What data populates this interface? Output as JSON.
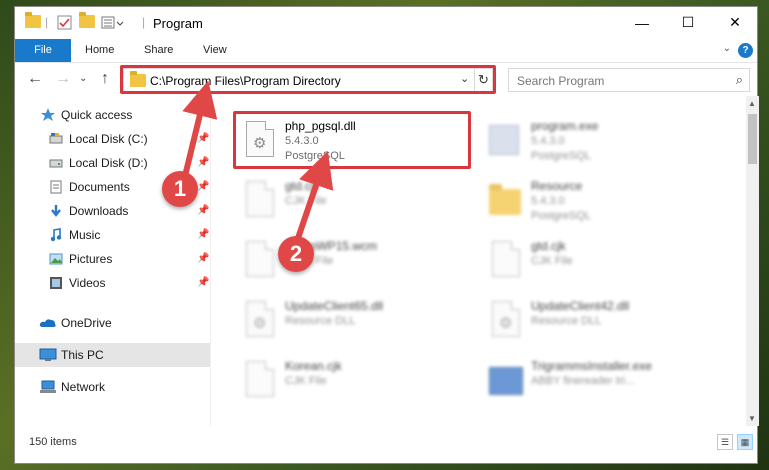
{
  "window": {
    "title": "Program",
    "minimize": "—",
    "maximize": "☐",
    "close": "✕"
  },
  "ribbon": {
    "tabs": [
      "File",
      "Home",
      "Share",
      "View"
    ],
    "help": "?",
    "expand": "⌄"
  },
  "nav": {
    "back": "←",
    "forward": "→",
    "recent": "⌄",
    "up": "↑",
    "address": "C:\\Program Files\\Program Directory",
    "address_chevron": "⌄",
    "refresh": "↻",
    "search_placeholder": "Search Program",
    "search_icon": "⌕"
  },
  "sidebar": {
    "items": [
      {
        "label": "Quick access",
        "icon": "star-icon",
        "pinned": false
      },
      {
        "label": "Local Disk (C:)",
        "icon": "drive-icon",
        "pinned": true
      },
      {
        "label": "Local Disk (D:)",
        "icon": "drive-icon",
        "pinned": true
      },
      {
        "label": "Documents",
        "icon": "documents-icon",
        "pinned": true
      },
      {
        "label": "Downloads",
        "icon": "download-icon",
        "pinned": true
      },
      {
        "label": "Music",
        "icon": "music-icon",
        "pinned": true
      },
      {
        "label": "Pictures",
        "icon": "pictures-icon",
        "pinned": true
      },
      {
        "label": "Videos",
        "icon": "videos-icon",
        "pinned": true
      },
      {
        "label": "OneDrive",
        "icon": "cloud-icon",
        "pinned": false
      },
      {
        "label": "This PC",
        "icon": "pc-icon",
        "pinned": false,
        "selected": true
      },
      {
        "label": "Network",
        "icon": "network-icon",
        "pinned": false
      }
    ],
    "pin_glyph": "📌"
  },
  "files": [
    {
      "name": "php_pgsql.dll",
      "line2": "5.4.3.0",
      "line3": "PostgreSQL",
      "icon": "dll-gear-icon",
      "highlighted": true
    },
    {
      "name": "program.exe",
      "line2": "5.4.3.0",
      "line3": "PostgreSQL",
      "icon": "exe-icon"
    },
    {
      "name": "gtd.cjk",
      "line2": "CJK File",
      "line3": "",
      "icon": "file-icon"
    },
    {
      "name": "Resource",
      "line2": "5.4.3.0",
      "line3": "PostgreSQL",
      "icon": "folder-icon"
    },
    {
      "name": "SetupWP15.wcm",
      "line2": "WCM File",
      "line3": "",
      "icon": "file-icon"
    },
    {
      "name": "gtd.cjk",
      "line2": "CJK File",
      "line3": "",
      "icon": "file-icon"
    },
    {
      "name": "UpdateClient65.dll",
      "line2": "Resource DLL",
      "line3": "",
      "icon": "dll-gear-icon"
    },
    {
      "name": "UpdateClient42.dll",
      "line2": "Resource DLL",
      "line3": "",
      "icon": "dll-gear-icon"
    },
    {
      "name": "Korean.cjk",
      "line2": "CJK File",
      "line3": "",
      "icon": "file-icon"
    },
    {
      "name": "TrigrammsInstaller.exe",
      "line2": "ABBY finereader tri...",
      "line3": "",
      "icon": "installer-icon"
    }
  ],
  "status": {
    "item_count": "150 items",
    "view_details": "☰",
    "view_tiles": "▦"
  },
  "callouts": {
    "one": "1",
    "two": "2"
  },
  "colors": {
    "accent": "#1979ca",
    "highlight": "#d9363e",
    "folder": "#f2c443"
  }
}
